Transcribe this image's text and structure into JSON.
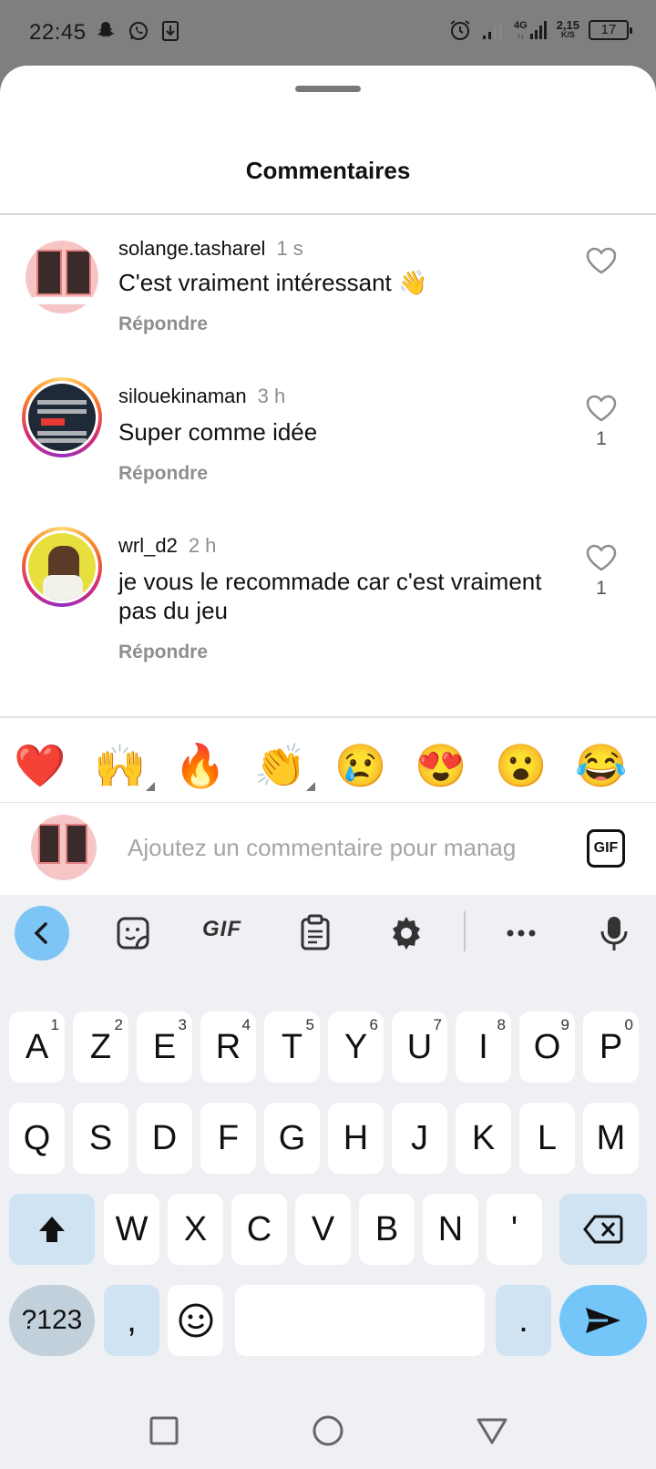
{
  "status_bar": {
    "time": "22:45",
    "network_label": "4G",
    "network_sub": "↑↓",
    "speed": "2,15",
    "speed_unit": "K/S",
    "battery": "17",
    "icons": [
      "snapchat-icon",
      "whatsapp-icon",
      "download-icon",
      "alarm-icon",
      "signal-icon",
      "signal-4g-icon",
      "battery-icon"
    ]
  },
  "sheet": {
    "title": "Commentaires"
  },
  "comments": [
    {
      "username": "solange.tasharel",
      "time": "1 s",
      "text": "C'est vraiment intéressant 👋",
      "reply_label": "Répondre",
      "likes": ""
    },
    {
      "username": "silouekinaman",
      "time": "3 h",
      "text": "Super comme idée",
      "reply_label": "Répondre",
      "likes": "1"
    },
    {
      "username": "wrl_d2",
      "time": "2 h",
      "text": "je vous le recommade car c'est vraiment pas du jeu",
      "reply_label": "Répondre",
      "likes": "1"
    }
  ],
  "emoji_bar": [
    "❤️",
    "🙌",
    "🔥",
    "👏",
    "😢",
    "😍",
    "😮",
    "😂"
  ],
  "composer": {
    "placeholder": "Ajoutez un commentaire pour manag",
    "gif_label": "GIF"
  },
  "keyboard": {
    "toolbar_gif": "GIF",
    "row1": [
      [
        "A",
        "1"
      ],
      [
        "Z",
        "2"
      ],
      [
        "E",
        "3"
      ],
      [
        "R",
        "4"
      ],
      [
        "T",
        "5"
      ],
      [
        "Y",
        "6"
      ],
      [
        "U",
        "7"
      ],
      [
        "I",
        "8"
      ],
      [
        "O",
        "9"
      ],
      [
        "P",
        "0"
      ]
    ],
    "row2": [
      "Q",
      "S",
      "D",
      "F",
      "G",
      "H",
      "J",
      "K",
      "L",
      "M"
    ],
    "row3": [
      "W",
      "X",
      "C",
      "V",
      "B",
      "N",
      "'"
    ],
    "symbols_label": "?123",
    "comma": ",",
    "period": "."
  },
  "colors": {
    "accent_blue": "#74c6f8",
    "muted_text": "#8e8e8e",
    "heart_red": "#e53935"
  }
}
